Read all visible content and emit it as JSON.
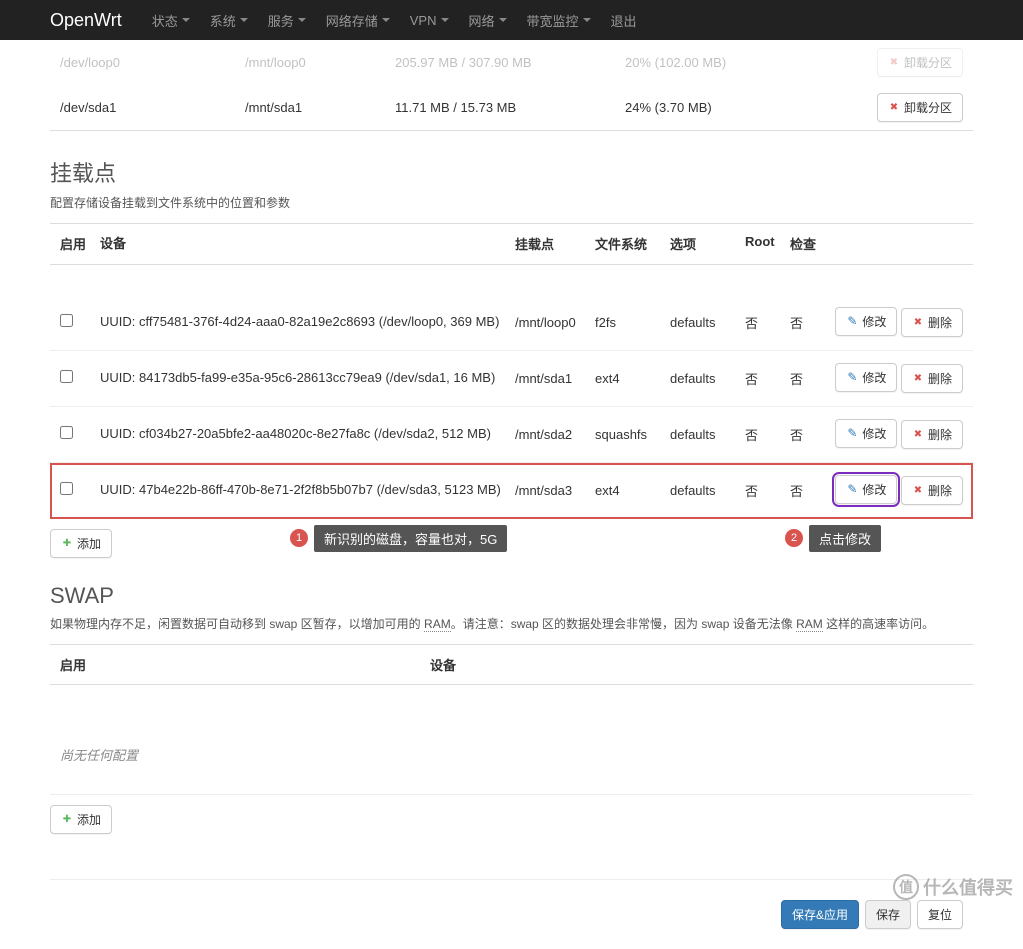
{
  "navbar": {
    "brand": "OpenWrt",
    "items": [
      "状态",
      "系统",
      "服务",
      "网络存储",
      "VPN",
      "网络",
      "带宽监控",
      "退出"
    ]
  },
  "storage": {
    "rows": [
      {
        "dev": "/dev/loop0",
        "mount": "/mnt/loop0",
        "size": "205.97 MB / 307.90 MB",
        "usage": "20% (102.00 MB)",
        "btn": "卸载分区"
      },
      {
        "dev": "/dev/sda1",
        "mount": "/mnt/sda1",
        "size": "11.71 MB / 15.73 MB",
        "usage": "24% (3.70 MB)",
        "btn": "卸载分区"
      }
    ]
  },
  "mounts": {
    "title": "挂载点",
    "desc": "配置存储设备挂载到文件系统中的位置和参数",
    "headers": {
      "enable": "启用",
      "device": "设备",
      "mount": "挂载点",
      "fs": "文件系统",
      "opt": "选项",
      "root": "Root",
      "check": "检查"
    },
    "btn_edit": "修改",
    "btn_delete": "删除",
    "btn_add": "添加",
    "rows": [
      {
        "device": "UUID: cff75481-376f-4d24-aaa0-82a19e2c8693 (/dev/loop0, 369 MB)",
        "mount": "/mnt/loop0",
        "fs": "f2fs",
        "opt": "defaults",
        "root": "否",
        "check": "否"
      },
      {
        "device": "UUID: 84173db5-fa99-e35a-95c6-28613cc79ea9 (/dev/sda1, 16 MB)",
        "mount": "/mnt/sda1",
        "fs": "ext4",
        "opt": "defaults",
        "root": "否",
        "check": "否"
      },
      {
        "device": "UUID: cf034b27-20a5bfe2-aa48020c-8e27fa8c (/dev/sda2, 512 MB)",
        "mount": "/mnt/sda2",
        "fs": "squashfs",
        "opt": "defaults",
        "root": "否",
        "check": "否"
      },
      {
        "device": "UUID: 47b4e22b-86ff-470b-8e71-2f2f8b5b07b7 (/dev/sda3, 5123 MB)",
        "mount": "/mnt/sda3",
        "fs": "ext4",
        "opt": "defaults",
        "root": "否",
        "check": "否",
        "highlight": true
      }
    ]
  },
  "annotations": {
    "a1": {
      "num": "1",
      "text": "新识别的磁盘，容量也对，5G"
    },
    "a2": {
      "num": "2",
      "text": "点击修改"
    }
  },
  "swap": {
    "title": "SWAP",
    "desc_pre": "如果物理内存不足，闲置数据可自动移到 swap 区暂存，以增加可用的 ",
    "desc_mid": "。请注意：swap 区的数据处理会非常慢，因为 swap 设备无法像 ",
    "desc_post": " 这样的高速率访问。",
    "ram": "RAM",
    "headers": {
      "enable": "启用",
      "device": "设备"
    },
    "empty": "尚无任何配置",
    "btn_add": "添加"
  },
  "footer": {
    "save_apply": "保存&应用",
    "save": "保存",
    "reset": "复位"
  },
  "watermark": {
    "icon": "值",
    "text": "什么值得买"
  }
}
